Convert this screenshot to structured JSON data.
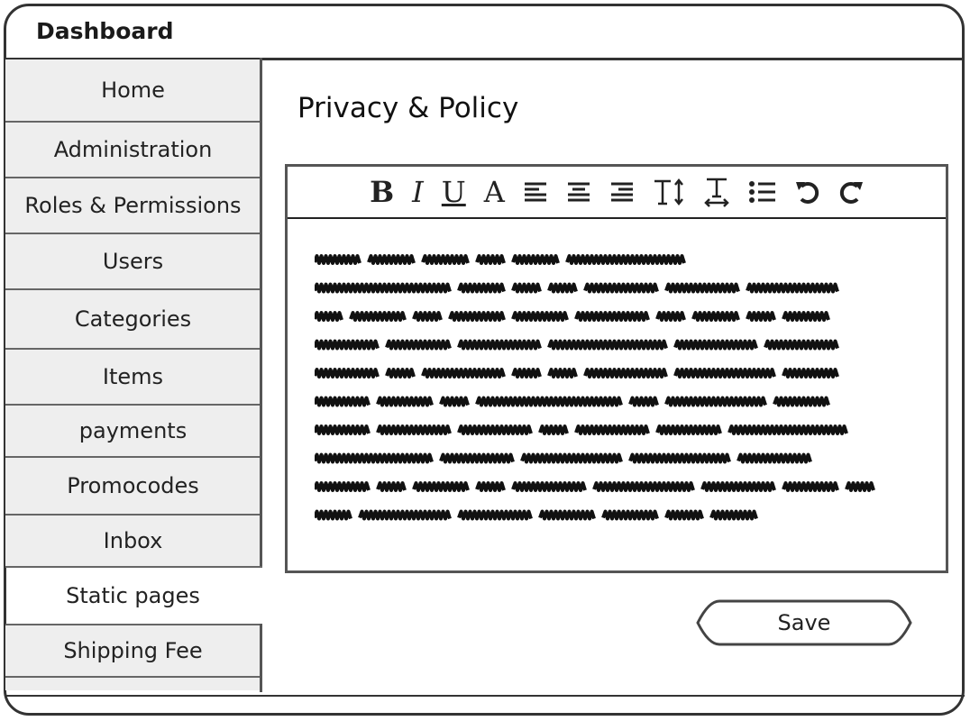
{
  "app": {
    "title": "Dashboard"
  },
  "sidebar": {
    "items": [
      {
        "label": "Home",
        "selected": false
      },
      {
        "label": "Administration",
        "selected": false
      },
      {
        "label": "Roles & Permissions",
        "selected": false
      },
      {
        "label": "Users",
        "selected": false
      },
      {
        "label": "Categories",
        "selected": false
      },
      {
        "label": "Items",
        "selected": false
      },
      {
        "label": "payments",
        "selected": false
      },
      {
        "label": "Promocodes",
        "selected": false
      },
      {
        "label": "Inbox",
        "selected": false
      },
      {
        "label": "Static pages",
        "selected": true
      },
      {
        "label": "Shipping Fee",
        "selected": false
      }
    ]
  },
  "main": {
    "title": "Privacy & Policy",
    "editor": {
      "toolbar": [
        "bold-icon",
        "italic-icon",
        "underline-icon",
        "font-color-icon",
        "align-left-icon",
        "align-center-icon",
        "align-right-icon",
        "text-height-icon",
        "text-width-icon",
        "bullet-list-icon",
        "undo-icon",
        "redo-icon"
      ],
      "toolbar_glyphs": {
        "bold": "B",
        "italic": "I",
        "underline": "U",
        "font_color": "A"
      },
      "content_lines": 10
    },
    "save_label": "Save"
  },
  "colors": {
    "stroke": "#333333",
    "shaded": "#eeeeee",
    "text": "#222222"
  }
}
